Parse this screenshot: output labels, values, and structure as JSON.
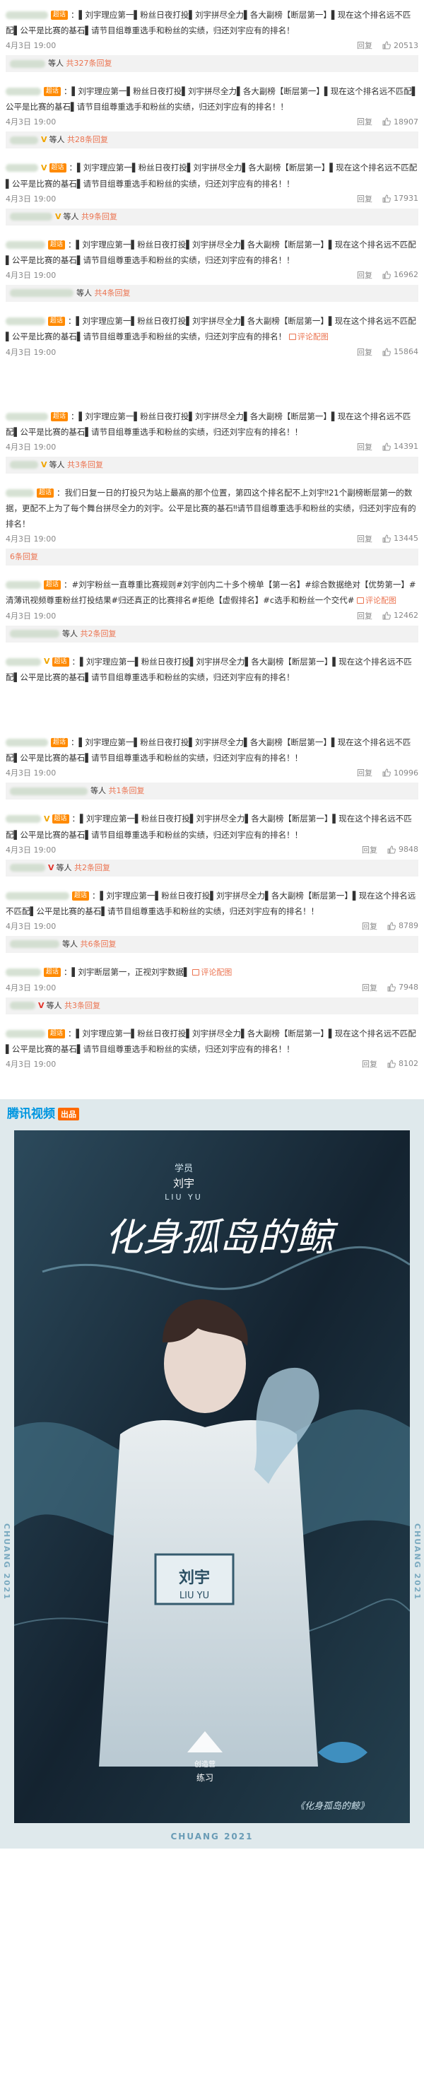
{
  "common": {
    "date": "4月3日 19:00",
    "reply_label": "回复",
    "badge": "超话",
    "vip": "V",
    "etc": "等人",
    "colon": "：",
    "photo_label": "评论配图"
  },
  "msg_main": "▌刘宇理应第一▌粉丝日夜打投▌刘宇拼尽全力▌各大副榜【断层第一】▌现在这个排名远不匹配▌公平是比赛的基石▌请节目组尊重选手和粉丝的实绩，归还刘宇应有的排名！",
  "msg_main_alt": "▌刘宇理应第一▌粉丝日夜打投▌刘宇拼尽全力▌各大副榜【断层第一】▌现在这个排名远不匹配▌公平是比赛的基石▌请节目组尊重选手和粉丝的实绩，归还刘宇应有的排名！！",
  "panel1": [
    {
      "reply_count": "共327条回复",
      "likes": "20513"
    },
    {
      "reply_count": "共28条回复",
      "likes": "18907"
    },
    {
      "reply_count": "共9条回复",
      "likes": "17931"
    },
    {
      "reply_count": "共4条回复",
      "likes": "16962"
    },
    {
      "likes": "15864"
    }
  ],
  "panel2": [
    {
      "reply_count": "共3条回复",
      "likes": "14391"
    },
    {
      "text": "我们日复一日的打投只为站上最高的那个位置，第四这个排名配不上刘宇‼21个副榜断层第一的数据，更配不上为了每个舞台拼尽全力的刘宇。公平是比赛的基石‼请节目组尊重选手和粉丝的实绩，归还刘宇应有的排名！",
      "reply_count": "6条回复",
      "likes": "13445"
    },
    {
      "text": "#刘宇粉丝一直尊重比赛规则#刘宇创内二十多个榜单【第一名】#综合数据绝对【优势第一】#清薄讯视频尊重粉丝打投结果#归还真正的比赛排名#拒绝【虚假排名】#c选手和粉丝一个交代#",
      "reply_count": "共2条回复",
      "likes": "12462"
    },
    {
      "text": "▌刘宇理应第一▌粉丝日夜打投▌刘宇拼尽全力▌各大副榜【断层第一】▌现在这个排名远不匹配▌公平是比赛的基石▌请节目组尊重选手和粉丝的实绩，归还刘宇应有的排名！"
    }
  ],
  "panel3": [
    {
      "reply_count": "共1条回复",
      "likes": "10996"
    },
    {
      "reply_count": "共2条回复",
      "likes": "9848"
    },
    {
      "reply_count": "共6条回复",
      "likes": "8789"
    },
    {
      "text": "▌刘宇断层第一，正视刘宇数据▌",
      "reply_count": "共3条回复",
      "likes": "7948"
    },
    {
      "likes": "8102"
    }
  ],
  "poster": {
    "logo": "腾讯视频",
    "logo_tag": "出品",
    "trainee_label": "学员",
    "name_cn": "刘宇",
    "name_en": "LIU YU",
    "title_script": "化身孤岛的鲸",
    "side_text": "CHUANG 2021",
    "bottom_text": "CHUANG 2021",
    "caption": "《化身孤岛的鲸》",
    "jersey": "刘宇",
    "jersey_en": "LIU YU",
    "show_logo": "创造营",
    "show_logo_sub": "练习"
  },
  "colors": {
    "accent": "#eb7350",
    "badge": "#ff8a00",
    "poster_bg": "#1a2a36"
  }
}
